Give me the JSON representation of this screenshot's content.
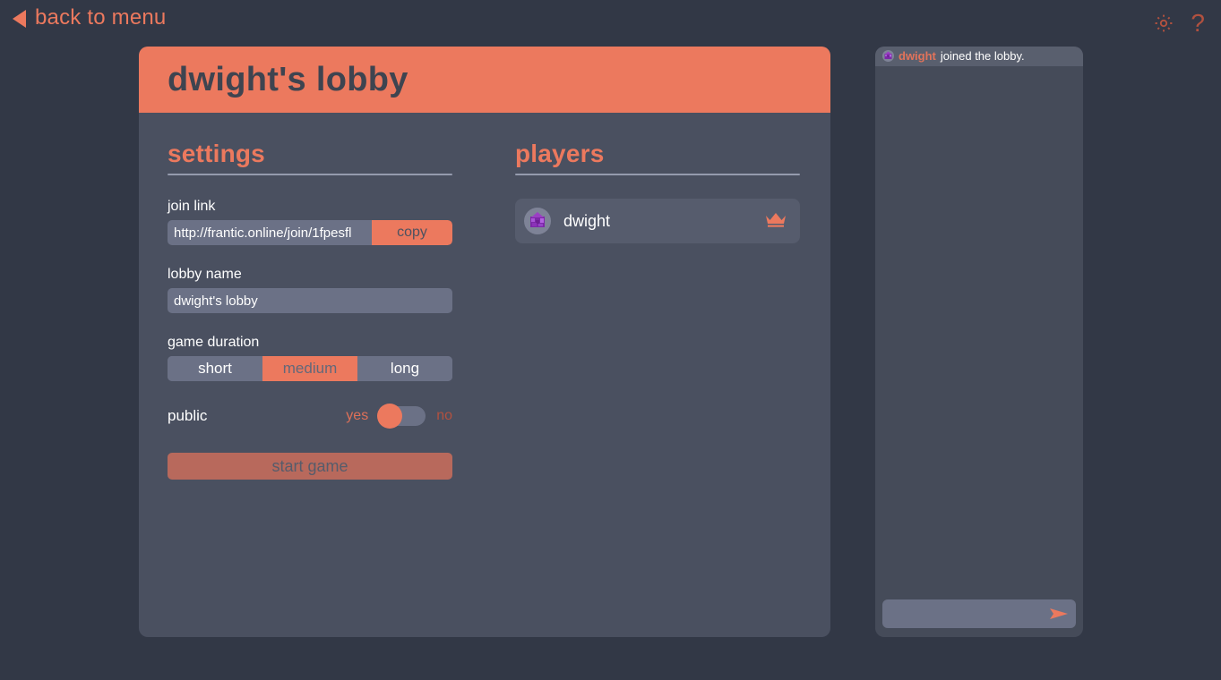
{
  "topbar": {
    "back_label": "back to menu",
    "back_icon": "left-triangle-icon",
    "settings_icon": "gear-icon",
    "help_icon": "?",
    "accent": "#ec795e",
    "icon_color": "#b2513f"
  },
  "lobby": {
    "title": "dwight's lobby",
    "header_bg": "#ec795e",
    "card_bg": "#4a5060"
  },
  "settings": {
    "heading": "settings",
    "join_link": {
      "label": "join link",
      "value": "http://frantic.online/join/1fpesfl",
      "copy_label": "copy"
    },
    "lobby_name": {
      "label": "lobby name",
      "value": "dwight's lobby"
    },
    "game_duration": {
      "label": "game duration",
      "options": [
        "short",
        "medium",
        "long"
      ],
      "selected": "medium"
    },
    "public": {
      "label": "public",
      "yes_label": "yes",
      "no_label": "no",
      "value": "yes"
    },
    "start_game_label": "start game"
  },
  "players": {
    "heading": "players",
    "list": [
      {
        "name": "dwight",
        "host": true,
        "avatar": "purple-crystal-avatar",
        "host_icon": "crown-icon"
      }
    ]
  },
  "chat": {
    "messages": [
      {
        "author": "dwight",
        "text": "joined the lobby.",
        "avatar": "purple-crystal-avatar"
      }
    ],
    "input_value": "",
    "input_placeholder": "",
    "send_icon": "send-arrow-icon"
  }
}
